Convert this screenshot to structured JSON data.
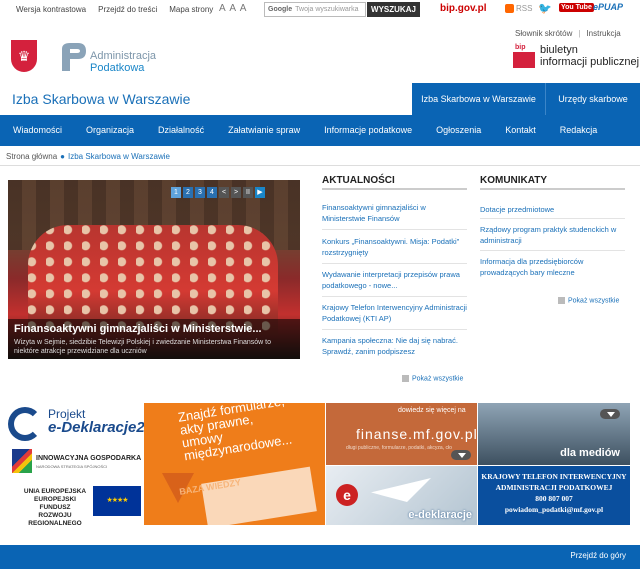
{
  "topbar": {
    "links": [
      "Wersja kontrastowa",
      "Przejdź do treści",
      "Mapa strony"
    ],
    "font_sizes": "A A A",
    "search_brand": "Google",
    "search_placeholder": "Twoja wyszukiwarka",
    "search_button": "WYSZUKAJ",
    "bip": "bip.gov.pl",
    "rss": "RSS",
    "youtube": "You Tube",
    "epuap": "ePUAP"
  },
  "header": {
    "ap_name_1": "Administracja",
    "ap_name_2": "Podatkowa",
    "links": [
      "Słownik skrótów",
      "Instrukcja"
    ],
    "bip_logo_mark": "bip",
    "bip_line1": "biuletyn",
    "bip_line2": "informacji publicznej",
    "office_title": "Izba Skarbowa w Warszawie",
    "tab_izba": "Izba Skarbowa w Warszawie",
    "tab_urzedy": "Urzędy skarbowe"
  },
  "nav": [
    "Wiadomości",
    "Organizacja",
    "Działalność",
    "Załatwianie spraw",
    "Informacje podatkowe",
    "Ogłoszenia",
    "Kontakt",
    "Redakcja"
  ],
  "breadcrumb": {
    "home": "Strona główna",
    "current": "Izba Skarbowa w Warszawie"
  },
  "slider": {
    "pages": [
      "1",
      "2",
      "3",
      "4",
      "<",
      ">",
      "II",
      "▶"
    ],
    "title": "Finansoaktywni gimnazjaliści w Ministerstwie...",
    "text": "Wizyta w Sejmie, siedzibie Telewizji Polskiej i zwiedzanie Ministerstwa Finansów to niektóre atrakcje przewidziane dla uczniów"
  },
  "news": {
    "heading": "AKTUALNOŚCI",
    "items": [
      "Finansoaktywni gimnazjaliści w Ministerstwie Finansów",
      "Konkurs „Finansoaktywni. Misja: Podatki\" rozstrzygnięty",
      "Wydawanie interpretacji przepisów prawa podatkowego - nowe...",
      "Krajowy Telefon Interwencyjny Administracji Podatkowej (KTI AP)",
      "Kampania społeczna: Nie daj się nabrać. Sprawdź, zanim podpiszesz"
    ],
    "show_all": "Pokaż wszystkie"
  },
  "communications": {
    "heading": "KOMUNIKATY",
    "items": [
      "Dotacje przedmiotowe",
      "Rządowy program praktyk studenckich w administracji",
      "Informacja dla przedsiębiorców prowadzących bary mleczne"
    ],
    "show_all": "Pokaż wszystkie"
  },
  "banners": {
    "edekl_1": "Projekt",
    "edekl_2": "e-Deklaracje2",
    "ig_1": "INNOWACYJNA GOSPODARKA",
    "ig_2": "NARODOWA STRATEGIA SPÓJNOŚCI",
    "ue_1": "UNIA EUROPEJSKA",
    "ue_2": "EUROPEJSKI FUNDUSZ",
    "ue_3": "ROZWOJU REGIONALNEGO",
    "baza_1": "Znajdź formularze,",
    "baza_2": "akty prawne,",
    "baza_3": "umowy",
    "baza_4": "międzynarodowe...",
    "baza_5": "BAZA WIEDZY",
    "finanse_0": "dowiedz się więcej na",
    "finanse_1": "finanse.mf.gov.pl",
    "finanse_2": "długi publiczne, formularze, podatki, akcyza, cło",
    "media": "dla mediów",
    "edek": "e-deklaracje",
    "ktip_1": "KRAJOWY TELEFON INTERWENCYJNY",
    "ktip_2": "ADMINISTRACJI PODATKOWEJ",
    "ktip_3": "800 807 007",
    "ktip_4": "powiadom_podatki@mf.gov.pl"
  },
  "footer": {
    "back_to_top": "Przejdź do góry"
  },
  "colors": {
    "brand_blue": "#0a64b4",
    "link_blue": "#1a70b8",
    "accent_orange": "#ef7d1a"
  }
}
